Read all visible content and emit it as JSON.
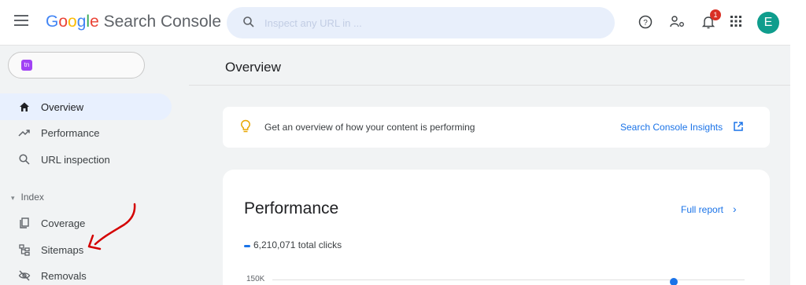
{
  "app": {
    "brand_google": [
      "G",
      "o",
      "o",
      "g",
      "l",
      "e"
    ],
    "brand_product": "Search Console"
  },
  "search": {
    "placeholder": "Inspect any URL in ..."
  },
  "topbar": {
    "icons": [
      "help-icon",
      "manage-users-icon",
      "notifications-icon",
      "apps-grid-icon"
    ],
    "notification_count": "1",
    "avatar_letter": "E"
  },
  "sidebar": {
    "property_badge": "tn",
    "items": [
      {
        "label": "Overview",
        "icon": "home-icon",
        "active": true
      },
      {
        "label": "Performance",
        "icon": "trending-up-icon",
        "active": false
      },
      {
        "label": "URL inspection",
        "icon": "search-icon",
        "active": false
      }
    ],
    "section": {
      "label": "Index",
      "arrow": "▾"
    },
    "index_items": [
      {
        "label": "Coverage",
        "icon": "coverage-icon"
      },
      {
        "label": "Sitemaps",
        "icon": "sitemap-icon"
      },
      {
        "label": "Removals",
        "icon": "removals-icon"
      }
    ]
  },
  "main": {
    "page_title": "Overview",
    "insights": {
      "text": "Get an overview of how your content is performing",
      "link": "Search Console Insights"
    },
    "performance": {
      "title": "Performance",
      "full_report": "Full report",
      "legend": "6,210,071 total clicks",
      "y_tick": "150K"
    }
  },
  "colors": {
    "accent": "#1a73e8",
    "active_nav_bg": "#e8f0fe",
    "search_bg": "#e8effb",
    "badge_red": "#d93025",
    "avatar": "#0f9d8d",
    "annotation_red": "#d40000"
  }
}
